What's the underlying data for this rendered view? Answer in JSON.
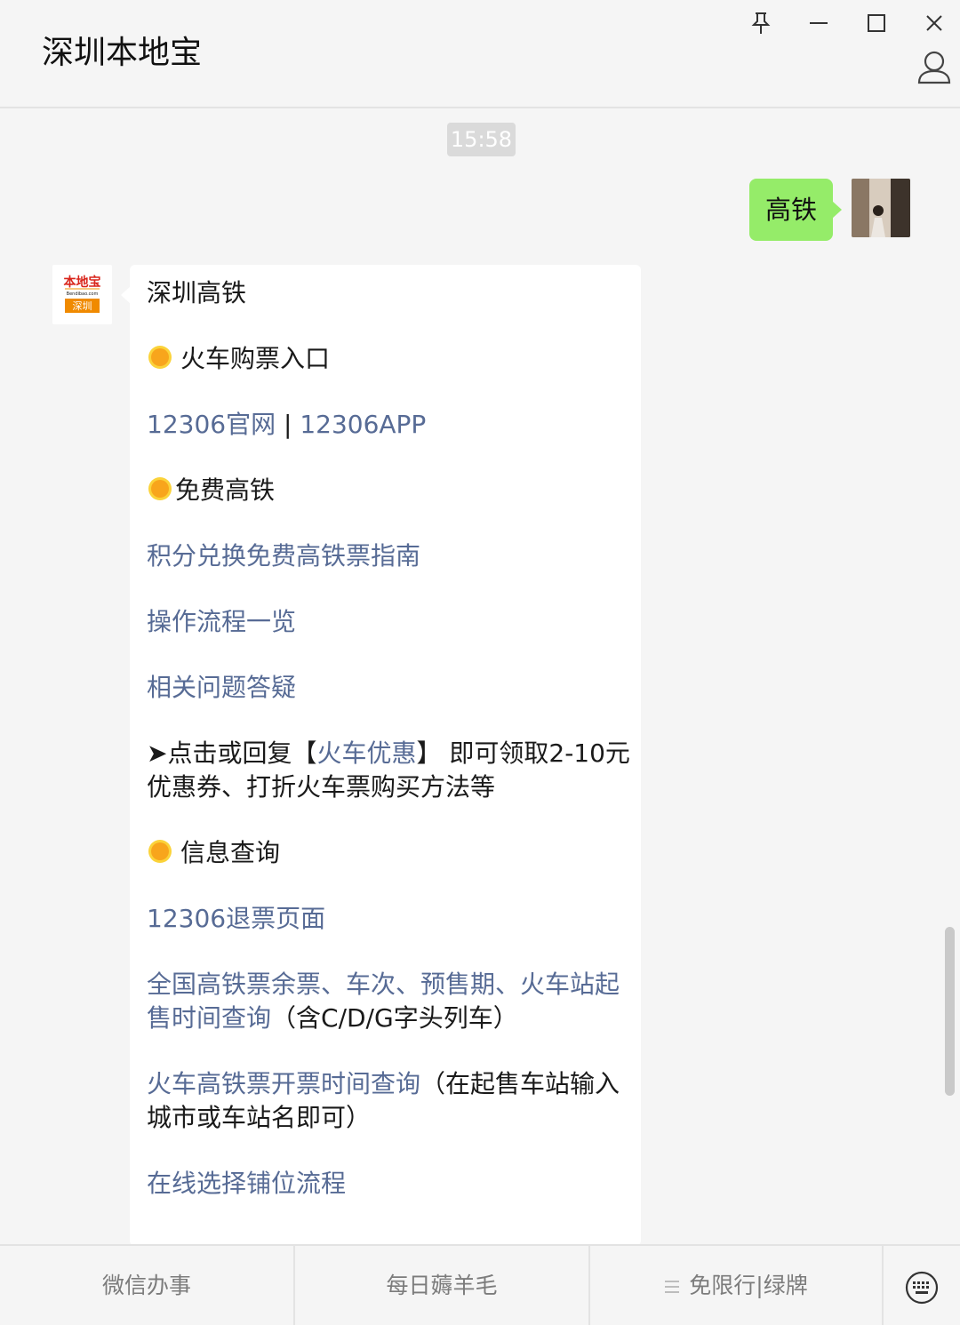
{
  "app": {
    "title": "深圳本地宝"
  },
  "chat": {
    "time": "15:58",
    "my_message": "高铁",
    "bot_message": {
      "heading": "深圳高铁",
      "section1": "火车购票入口",
      "links1_a": "12306官网",
      "links1_sep": " | ",
      "links1_b": "12306APP",
      "section2": "免费高铁",
      "link_points": "积分兑换免费高铁票指南",
      "link_process": "操作流程一览",
      "link_faq": "相关问题答疑",
      "promo_prefix": "➤点击或回复【",
      "promo_link": "火车优惠",
      "promo_suffix": "】 即可领取2-10元",
      "promo_line2": "优惠券、打折火车票购买方法等",
      "section3": "信息查询",
      "link_refund": "12306退票页面",
      "link_national_1": "全国高铁票余票、车次、预售期、火车站起",
      "link_national_2": "售时间查询",
      "national_note": "（含C/D/G字头列车）",
      "link_open_time": "火车高铁票开票时间查询",
      "open_time_note_1": "（在起售车站输入",
      "open_time_note_2": "城市或车站名即可）",
      "link_berth": "在线选择铺位流程"
    },
    "bot_avatar": {
      "brand": "本地宝",
      "domain": "Bendibao.com",
      "city": "深圳"
    }
  },
  "menu": {
    "items": [
      {
        "label": "微信办事"
      },
      {
        "label": "每日薅羊毛"
      },
      {
        "label": "免限行|绿牌",
        "icon": "submenu-icon"
      }
    ]
  },
  "colors": {
    "link": "#576b95",
    "my_bubble": "#95ec69",
    "accent_sun": "#f8a51c"
  }
}
